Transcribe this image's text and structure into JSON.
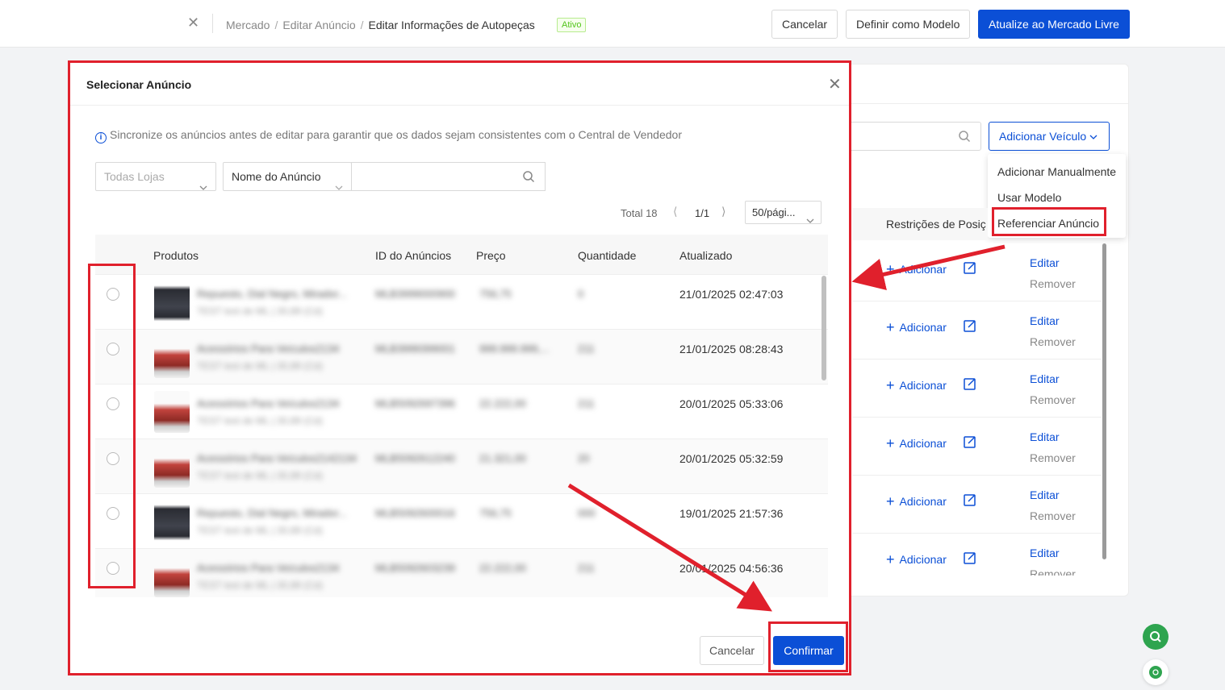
{
  "header": {
    "breadcrumb": [
      "Mercado",
      "Editar Anúncio",
      "Editar Informações de Autopeças"
    ],
    "badge": "Ativo",
    "cancel_label": "Cancelar",
    "template_label": "Definir como Modelo",
    "update_label": "Atualize ao Mercado Livre"
  },
  "background": {
    "add_vehicle_label": "Adicionar Veículo",
    "dropdown": [
      "Adicionar Manualmente",
      "Usar Modelo",
      "Referenciar Anúncio"
    ],
    "column_header": "Restrições de Posiç",
    "row_add_label": "Adicionar",
    "row_edit_label": "Editar",
    "row_remove_label": "Remover"
  },
  "modal": {
    "title": "Selecionar Anúncio",
    "info": "Sincronize os anúncios antes de editar para garantir que os dados sejam consistentes com o Central de Vendedor",
    "store_placeholder": "Todas Lojas",
    "field_select": "Nome do Anúncio",
    "pager": {
      "total": "Total 18",
      "page": "1/1",
      "size": "50/pági..."
    },
    "columns": [
      "Produtos",
      "ID do Anúncios",
      "Preço",
      "Quantidade",
      "Atualizado"
    ],
    "rows": [
      {
        "name": "Repuesto, Dial Negro, Mirador...",
        "sub": "TEST test de ML | 30,89 (Cd)",
        "id": "MLB3999000900",
        "price": "756,75",
        "qty": "0",
        "updated": "21/01/2025 02:47:03",
        "thumb": "dark"
      },
      {
        "name": "Acessórios Para Veículos2134",
        "sub": "TEST test de ML | 30,89 (Cd)",
        "id": "MLB3999399001",
        "price": "999.999.999,...",
        "qty": "211",
        "updated": "21/01/2025 08:28:43",
        "thumb": "red"
      },
      {
        "name": "Acessórios Para Veículos2134",
        "sub": "TEST test de ML | 30,89 (Cd)",
        "id": "MLB5092697396",
        "price": "22.222,00",
        "qty": "211",
        "updated": "20/01/2025 05:33:06",
        "thumb": "red"
      },
      {
        "name": "Acessórios Para Veículos2142134",
        "sub": "TEST test de ML | 30,89 (Cd)",
        "id": "MLB5092612240",
        "price": "21.321,00",
        "qty": "20",
        "updated": "20/01/2025 05:32:59",
        "thumb": "red"
      },
      {
        "name": "Repuesto, Dial Negro, Mirador...",
        "sub": "TEST test de ML | 30,89 (Cd)",
        "id": "MLB5092600016",
        "price": "756,75",
        "qty": "000",
        "updated": "19/01/2025 21:57:36",
        "thumb": "dark"
      },
      {
        "name": "Acessórios Para Veículos2134",
        "sub": "TEST test de ML | 30,89 (Cd)",
        "id": "MLB5092603239",
        "price": "22.222,00",
        "qty": "211",
        "updated": "20/01/2025 04:56:36",
        "thumb": "red"
      }
    ],
    "cancel_label": "Cancelar",
    "confirm_label": "Confirmar"
  },
  "colors": {
    "primary": "#0b4fd6",
    "annotation": "#e0202c",
    "fab_green": "#2ea44f",
    "badge_green": "#52c41a"
  },
  "icons": [
    "close-icon",
    "search-icon",
    "chevron-down-icon",
    "info-icon",
    "edit-icon",
    "plus-icon",
    "whatsapp-icon"
  ]
}
